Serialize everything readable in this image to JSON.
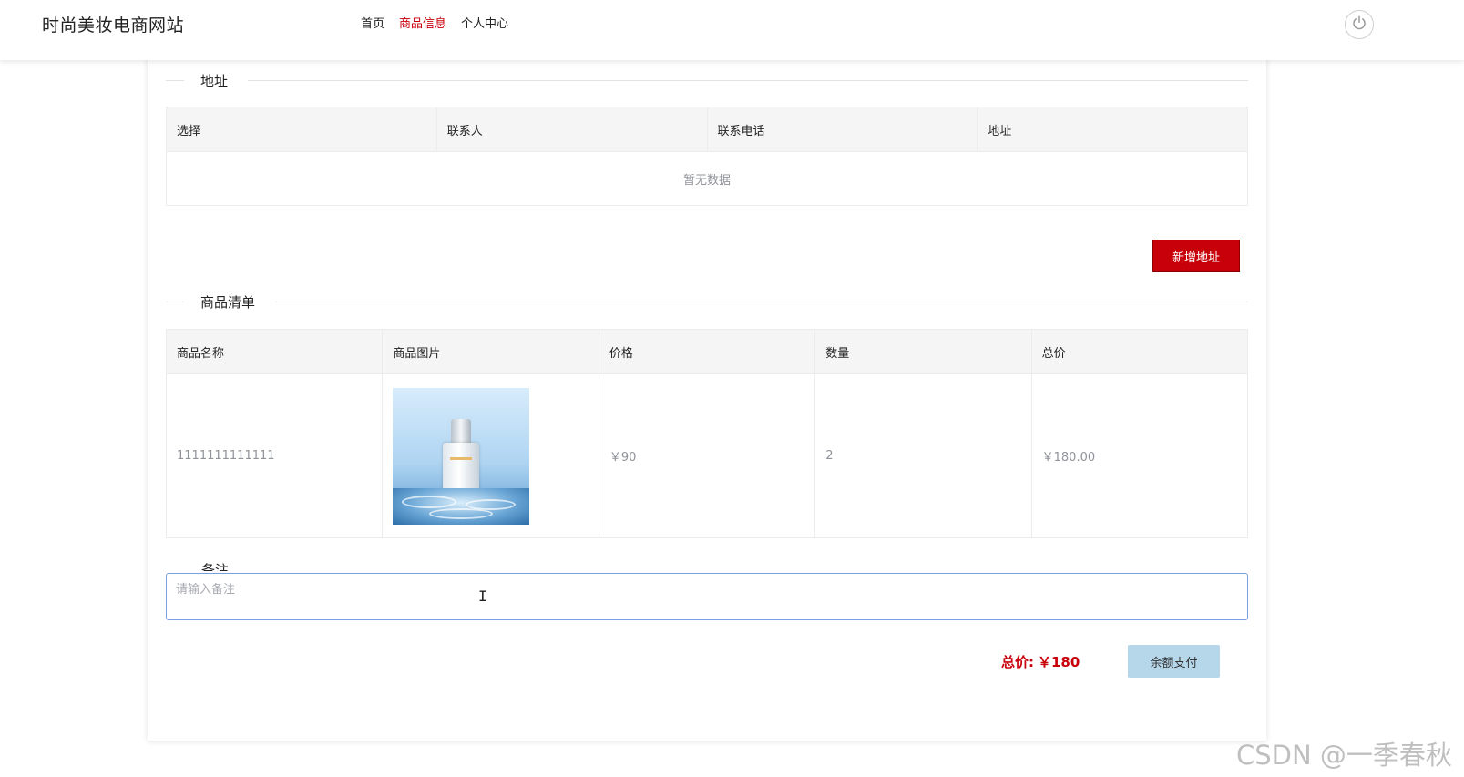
{
  "header": {
    "site_title": "时尚美妆电商网站",
    "nav": [
      {
        "label": "首页",
        "active": false
      },
      {
        "label": "商品信息",
        "active": true
      },
      {
        "label": "个人中心",
        "active": false
      }
    ],
    "power_icon": "power-icon"
  },
  "address_section": {
    "title": "地址",
    "columns": [
      "选择",
      "联系人",
      "联系电话",
      "地址"
    ],
    "empty_text": "暂无数据",
    "add_button": "新增地址"
  },
  "goods_section": {
    "title": "商品清单",
    "columns": [
      "商品名称",
      "商品图片",
      "价格",
      "数量",
      "总价"
    ],
    "rows": [
      {
        "name": "1111111111111",
        "image": "cosmetic-bottle-in-water",
        "price": "￥90",
        "quantity": "2",
        "total": "￥180.00"
      }
    ]
  },
  "note_section": {
    "title": "备注",
    "placeholder": "请输入备注",
    "value": ""
  },
  "footer": {
    "total_label": "总价:",
    "total_value": "￥180",
    "pay_button": "余额支付"
  },
  "colors": {
    "accent": "#c8000a",
    "pay_button_bg": "#b6d6ea"
  },
  "watermark": "CSDN @一季春秋"
}
